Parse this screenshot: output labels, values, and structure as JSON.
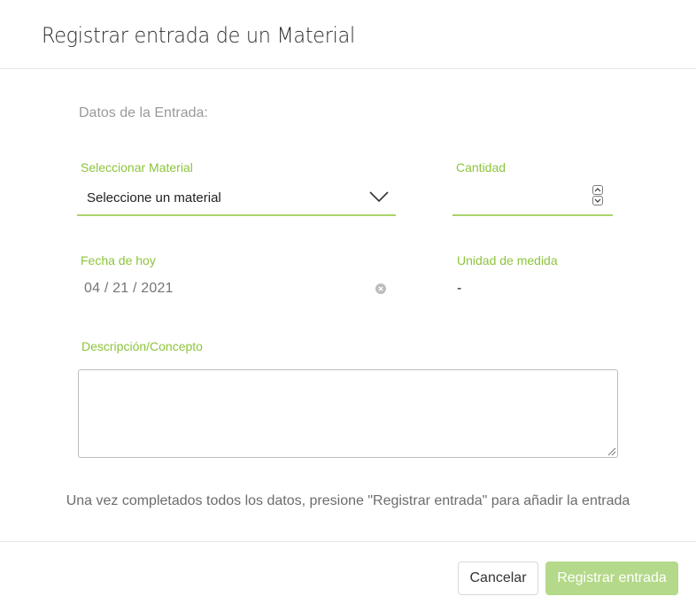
{
  "modal": {
    "title": "Registrar entrada de un Material"
  },
  "form": {
    "section_title": "Datos de la Entrada:",
    "material": {
      "label": "Seleccionar Material",
      "selected": "Seleccione un material"
    },
    "quantity": {
      "label": "Cantidad",
      "value": ""
    },
    "date": {
      "label": "Fecha de hoy",
      "value": "04 / 21 / 2021"
    },
    "unit": {
      "label": "Unidad de medida",
      "value": "-"
    },
    "description": {
      "label": "Descripción/Concepto",
      "value": ""
    },
    "hint": "Una vez completados todos los datos, presione \"Registrar entrada\" para añadir la entrada"
  },
  "footer": {
    "cancel_label": "Cancelar",
    "submit_label": "Registrar entrada"
  },
  "colors": {
    "accent": "#8cc43c",
    "submit_bg": "#b4d98a"
  },
  "icons": {
    "select": "chevron-down-icon",
    "stepper_up": "chevron-up-icon",
    "stepper_down": "chevron-down-icon",
    "clear": "clear-icon",
    "resize": "resize-grip-icon"
  }
}
